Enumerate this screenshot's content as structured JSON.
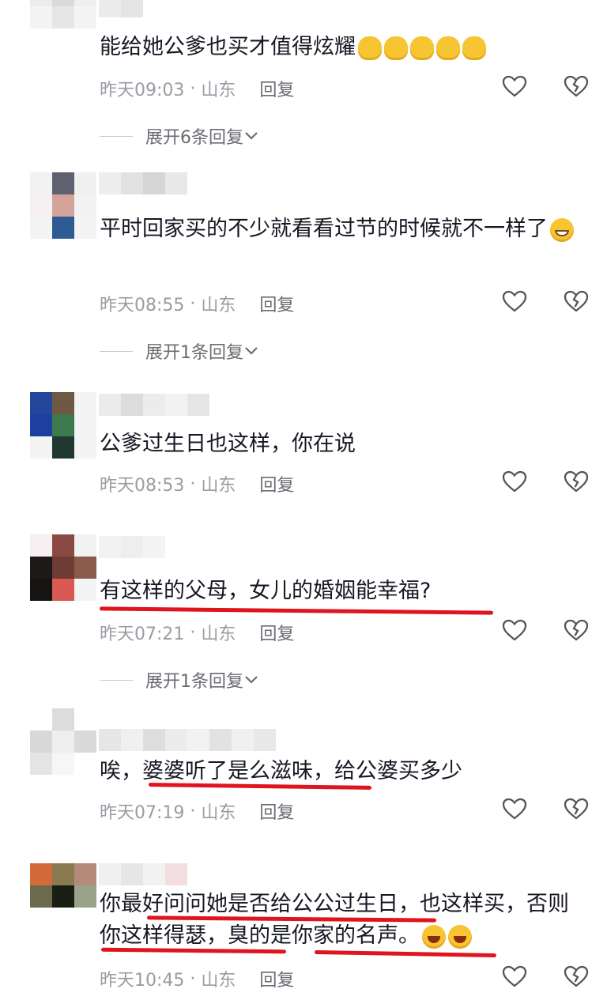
{
  "reply_label": "回复",
  "comments": [
    {
      "text": "能给她公爹也买才值得炫耀",
      "time": "昨天09:03",
      "location": "山东",
      "expand": "展开6条回复"
    },
    {
      "text": "平时回家买的不少就看看过节的时候就不一样了",
      "time": "昨天08:55",
      "location": "山东",
      "expand": "展开1条回复"
    },
    {
      "text": "公爹过生日也这样，你在说",
      "time": "昨天08:53",
      "location": "山东"
    },
    {
      "text": "有这样的父母，女儿的婚姻能幸福?",
      "time": "昨天07:21",
      "location": "山东",
      "expand": "展开1条回复"
    },
    {
      "text": "唉，婆婆听了是么滋味，给公婆买多少",
      "time": "昨天07:19",
      "location": "山东"
    },
    {
      "text": "你最好问问她是否给公公过生日，也这样买，否则你这样得瑟，臭的是你家的名声。",
      "time": "昨天10:45",
      "location": "山东"
    }
  ],
  "icons": {
    "like": "heart-outline-icon",
    "dislike": "broken-heart-icon"
  },
  "colors": {
    "annotation": "#e0141e",
    "meta": "#9b9ba3"
  }
}
